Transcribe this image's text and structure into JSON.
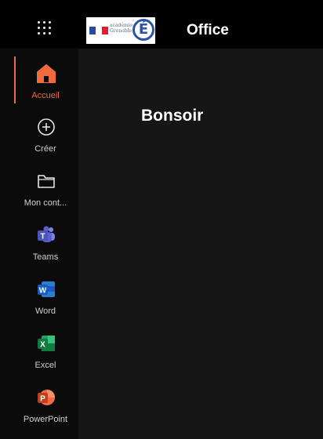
{
  "topbar": {
    "app_title": "Office",
    "logo_text_line1": "académie",
    "logo_text_line2": "Grenoble",
    "logo_letter": "É"
  },
  "sidebar": {
    "items": [
      {
        "label": "Accueil",
        "icon": "home-icon",
        "active": true
      },
      {
        "label": "Créer",
        "icon": "plus-circle-icon",
        "active": false
      },
      {
        "label": "Mon cont...",
        "icon": "folder-icon",
        "active": false
      },
      {
        "label": "Teams",
        "icon": "teams-icon",
        "active": false
      },
      {
        "label": "Word",
        "icon": "word-icon",
        "active": false
      },
      {
        "label": "Excel",
        "icon": "excel-icon",
        "active": false
      },
      {
        "label": "PowerPoint",
        "icon": "powerpoint-icon",
        "active": false
      }
    ]
  },
  "main": {
    "greeting": "Bonsoir"
  },
  "colors": {
    "accent": "#ef6a3d",
    "teams": "#5b5fc7",
    "word": "#185abd",
    "excel": "#107c41",
    "powerpoint": "#d24726"
  }
}
